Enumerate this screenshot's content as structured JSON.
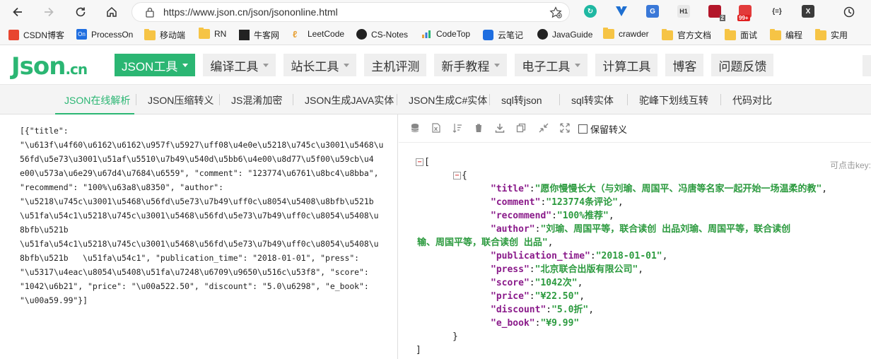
{
  "browser": {
    "url": "https://www.json.cn/json/jsononline.html",
    "badges": {
      "ext6": "2",
      "ext7": "99+"
    }
  },
  "bookmarks": [
    {
      "label": "CSDN博客",
      "icon": "csdn-icon"
    },
    {
      "label": "ProcessOn",
      "icon": "processon-icon"
    },
    {
      "label": "移动端",
      "icon": "folder-icon"
    },
    {
      "label": "RN",
      "icon": "folder-icon"
    },
    {
      "label": "牛客网",
      "icon": "nowcoder-icon"
    },
    {
      "label": "LeetCode",
      "icon": "leetcode-icon"
    },
    {
      "label": "CS-Notes",
      "icon": "github-icon"
    },
    {
      "label": "CodeTop",
      "icon": "chart-icon"
    },
    {
      "label": "云笔记",
      "icon": "note-icon"
    },
    {
      "label": "JavaGuide",
      "icon": "github-icon"
    },
    {
      "label": "crawder",
      "icon": "folder-icon"
    },
    {
      "label": "官方文档",
      "icon": "folder-icon"
    },
    {
      "label": "面试",
      "icon": "folder-icon"
    },
    {
      "label": "编程",
      "icon": "folder-icon"
    },
    {
      "label": "实用",
      "icon": "folder-icon"
    }
  ],
  "site": {
    "logo_main": "Json",
    "logo_suffix": ".cn",
    "nav": [
      {
        "label": "JSON工具",
        "dropdown": true,
        "active": true
      },
      {
        "label": "编译工具",
        "dropdown": true
      },
      {
        "label": "站长工具",
        "dropdown": true
      },
      {
        "label": "主机评测"
      },
      {
        "label": "新手教程",
        "dropdown": true
      },
      {
        "label": "电子工具",
        "dropdown": true
      },
      {
        "label": "计算工具"
      },
      {
        "label": "博客"
      },
      {
        "label": "问题反馈"
      }
    ],
    "subnav": [
      {
        "label": "JSON在线解析",
        "active": true
      },
      {
        "label": "JSON压缩转义"
      },
      {
        "label": "JS混淆加密"
      },
      {
        "label": "JSON生成JAVA实体"
      },
      {
        "label": "JSON生成C#实体"
      },
      {
        "label": "sql转json"
      },
      {
        "label": "sql转实体"
      },
      {
        "label": "驼峰下划线互转"
      },
      {
        "label": "代码对比"
      }
    ]
  },
  "editor": {
    "raw_lines": [
      "[{\"title\":",
      "\"\\u613f\\u4f60\\u6162\\u6162\\u957f\\u5927\\uff08\\u4e0e\\u5218\\u745c\\u3001\\u5468\\u",
      "56fd\\u5e73\\u3001\\u51af\\u5510\\u7b49\\u540d\\u5bb6\\u4e00\\u8d77\\u5f00\\u59cb\\u4",
      "e00\\u573a\\u6e29\\u67d4\\u7684\\u6559\", \"comment\": \"123774\\u6761\\u8bc4\\u8bba\",",
      "\"recommend\": \"100%\\u63a8\\u8350\", \"author\":",
      "\"\\u5218\\u745c\\u3001\\u5468\\u56fd\\u5e73\\u7b49\\uff0c\\u8054\\u5408\\u8bfb\\u521b",
      "\\u51fa\\u54c1\\u5218\\u745c\\u3001\\u5468\\u56fd\\u5e73\\u7b49\\uff0c\\u8054\\u5408\\u",
      "8bfb\\u521b",
      "\\u51fa\\u54c1\\u5218\\u745c\\u3001\\u5468\\u56fd\\u5e73\\u7b49\\uff0c\\u8054\\u5408\\u",
      "8bfb\\u521b   \\u51fa\\u54c1\", \"publication_time\": \"2018-01-01\", \"press\":",
      "\"\\u5317\\u4eac\\u8054\\u5408\\u51fa\\u7248\\u6709\\u9650\\u516c\\u53f8\", \"score\":",
      "\"1042\\u6b21\", \"price\": \"\\u00a522.50\", \"discount\": \"5.0\\u6298\", \"e_book\":",
      "\"\\u00a59.99\"}]"
    ],
    "keep_escape_label": "保留转义",
    "hint": "可点击key:",
    "parsed": {
      "open_array": "[",
      "open_object": "{",
      "close_object": "}",
      "close_array": "]",
      "fields": [
        {
          "key": "\"title\"",
          "value": "\"愿你慢慢长大（与刘瑜、周国平、冯唐等名家一起开始一场温柔的教\"",
          "tail": ","
        },
        {
          "key": "\"comment\"",
          "value": "\"123774条评论\"",
          "tail": ","
        },
        {
          "key": "\"recommend\"",
          "value": "\"100%推荐\"",
          "tail": ","
        },
        {
          "key": "\"author\"",
          "value": "\"刘瑜、周国平等，联合读创      出品刘瑜、周国平等，联合读创",
          "tail": ""
        },
        {
          "key": "",
          "value": "输、周国平等，联合读创      出品\"",
          "tail": ","
        },
        {
          "key": "\"publication_time\"",
          "value": "\"2018-01-01\"",
          "tail": ","
        },
        {
          "key": "\"press\"",
          "value": "\"北京联合出版有限公司\"",
          "tail": ","
        },
        {
          "key": "\"score\"",
          "value": "\"1042次\"",
          "tail": ","
        },
        {
          "key": "\"price\"",
          "value": "\"¥22.50\"",
          "tail": ","
        },
        {
          "key": "\"discount\"",
          "value": "\"5.0折\"",
          "tail": ","
        },
        {
          "key": "\"e_book\"",
          "value": "\"¥9.99\"",
          "tail": ""
        }
      ]
    }
  },
  "colors": {
    "brand": "#2bb673",
    "json_key": "#8a1a8a",
    "json_string": "#2b9a3e"
  }
}
